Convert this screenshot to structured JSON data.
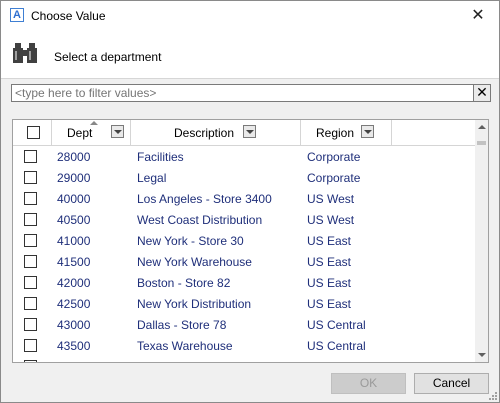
{
  "window": {
    "title": "Choose Value",
    "app_icon_letter": "A",
    "close_glyph": "✕"
  },
  "header": {
    "icon": "binoculars-icon",
    "prompt": "Select a department"
  },
  "filter": {
    "value": "",
    "placeholder": "<type here to filter values>",
    "clear_glyph": "✕"
  },
  "grid": {
    "columns": [
      {
        "label": "Dept",
        "sorted": "ascending"
      },
      {
        "label": "Description"
      },
      {
        "label": "Region"
      }
    ],
    "rows": [
      {
        "dept": "28000",
        "description": "Facilities",
        "region": "Corporate"
      },
      {
        "dept": "29000",
        "description": "Legal",
        "region": "Corporate"
      },
      {
        "dept": "40000",
        "description": "Los Angeles - Store 3400",
        "region": "US West"
      },
      {
        "dept": "40500",
        "description": "West Coast Distribution",
        "region": "US West"
      },
      {
        "dept": "41000",
        "description": "New York - Store 30",
        "region": "US East"
      },
      {
        "dept": "41500",
        "description": "New York Warehouse",
        "region": "US East"
      },
      {
        "dept": "42000",
        "description": "Boston - Store 82",
        "region": "US East"
      },
      {
        "dept": "42500",
        "description": "New York Distribution",
        "region": "US East"
      },
      {
        "dept": "43000",
        "description": "Dallas - Store 78",
        "region": "US Central"
      },
      {
        "dept": "43500",
        "description": "Texas Warehouse",
        "region": "US Central"
      }
    ]
  },
  "buttons": {
    "ok": "OK",
    "ok_enabled": false,
    "cancel": "Cancel"
  },
  "colors": {
    "cell_text": "#1f2f7a",
    "content_bg": "#f0f0f0"
  }
}
